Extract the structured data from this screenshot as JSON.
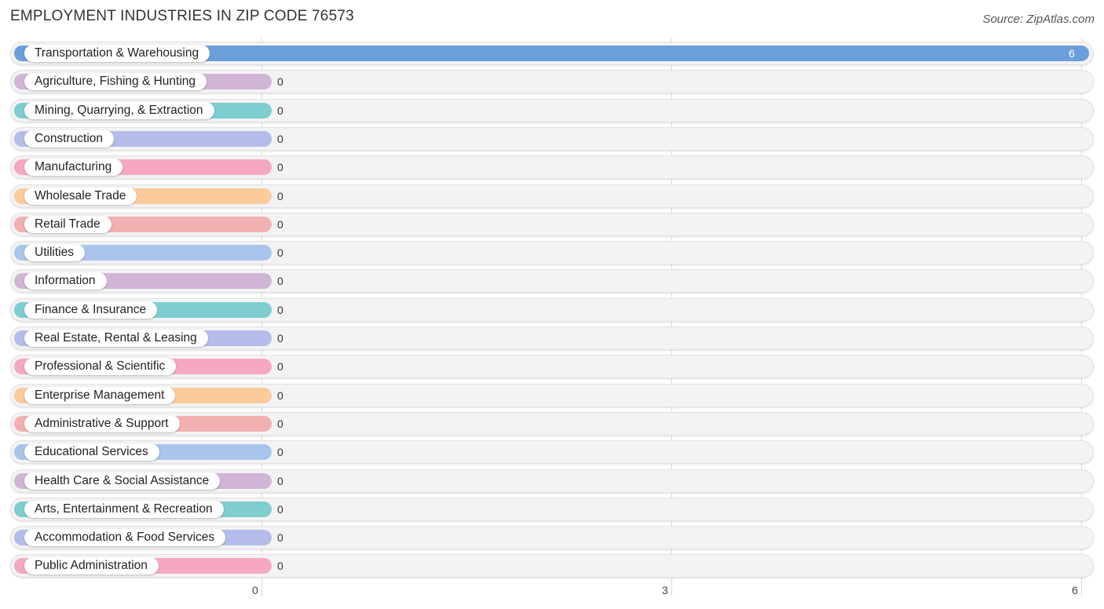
{
  "header": {
    "title": "EMPLOYMENT INDUSTRIES IN ZIP CODE 76573",
    "source": "Source: ZipAtlas.com"
  },
  "chart_data": {
    "type": "bar",
    "orientation": "horizontal",
    "title": "EMPLOYMENT INDUSTRIES IN ZIP CODE 76573",
    "xlabel": "",
    "ylabel": "",
    "xlim": [
      0,
      6
    ],
    "xticks": [
      "0",
      "3",
      "6"
    ],
    "grid": true,
    "categories": [
      "Transportation & Warehousing",
      "Agriculture, Fishing & Hunting",
      "Mining, Quarrying, & Extraction",
      "Construction",
      "Manufacturing",
      "Wholesale Trade",
      "Retail Trade",
      "Utilities",
      "Information",
      "Finance & Insurance",
      "Real Estate, Rental & Leasing",
      "Professional & Scientific",
      "Enterprise Management",
      "Administrative & Support",
      "Educational Services",
      "Health Care & Social Assistance",
      "Arts, Entertainment & Recreation",
      "Accommodation & Food Services",
      "Public Administration"
    ],
    "values": [
      6,
      0,
      0,
      0,
      0,
      0,
      0,
      0,
      0,
      0,
      0,
      0,
      0,
      0,
      0,
      0,
      0,
      0,
      0
    ],
    "value_labels": [
      "6",
      "0",
      "0",
      "0",
      "0",
      "0",
      "0",
      "0",
      "0",
      "0",
      "0",
      "0",
      "0",
      "0",
      "0",
      "0",
      "0",
      "0",
      "0"
    ],
    "colors": [
      "#6a9fdc",
      "#d1b5d6",
      "#7ecdd1",
      "#b4bde9",
      "#f6a8c2",
      "#fbcb9c",
      "#f2b0b0",
      "#a9c5ec",
      "#d1b5d6",
      "#7ecdd1",
      "#b4bde9",
      "#f6a8c2",
      "#fbcb9c",
      "#f2b0b0",
      "#a9c5ec",
      "#d1b5d6",
      "#7ecdd1",
      "#b4bde9",
      "#f6a8c2"
    ]
  }
}
